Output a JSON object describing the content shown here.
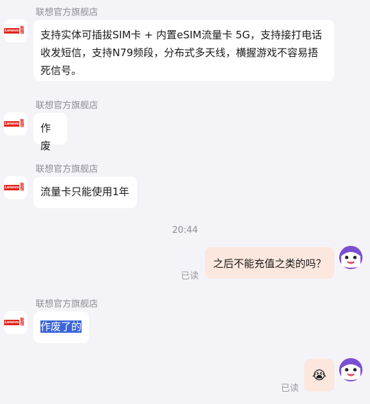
{
  "shop_name": "联想官方旗舰店",
  "logo": {
    "brand": "Lenovo",
    "cn": "联想"
  },
  "messages": [
    {
      "text": "支持实体可插拔SIM卡 + 内置eSIM流量卡 5G，支持接打电话收发短信，支持N79频段，分布式多天线，横握游戏不容易捂死信号。"
    },
    {
      "text": "作废"
    },
    {
      "text": "流量卡只能使用1年"
    }
  ],
  "timestamp": "20:44",
  "user_message": "之后不能充值之类的吗？",
  "read_label": "已读",
  "last_message": "作废了的",
  "emoji": "😭"
}
